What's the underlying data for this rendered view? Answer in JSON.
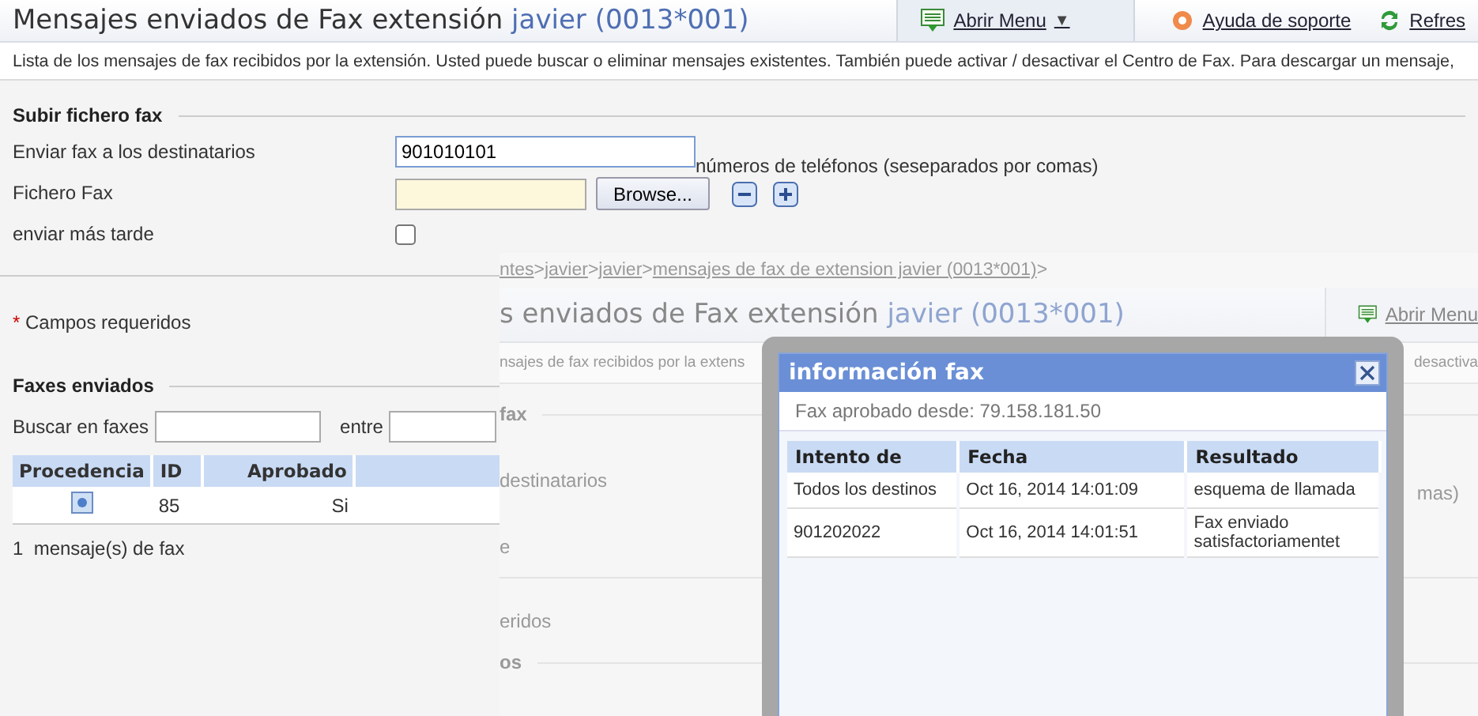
{
  "header": {
    "title": "Mensajes enviados de Fax extensión",
    "extension": "javier (0013*001)",
    "actions": [
      {
        "kind": "menu",
        "label": "Abrir Menu",
        "caret": "▼"
      },
      {
        "kind": "help",
        "label": "Ayuda de soporte"
      },
      {
        "kind": "refresh",
        "label": "Refres"
      }
    ]
  },
  "description": "Lista de los mensajes de fax recibidos por la extensión. Usted puede buscar o eliminar mensajes existentes. También puede activar / desactivar el Centro de Fax. Para descargar un mensaje,",
  "upload": {
    "heading": "Subir fichero fax",
    "recipients": {
      "label": "Enviar fax a los destinatarios",
      "value": "901010101",
      "hint": "números de teléfonos (seseparados por comas)"
    },
    "file": {
      "label": "Fichero Fax",
      "button": "Browse..."
    },
    "later": {
      "label": "enviar más tarde",
      "checked": false
    }
  },
  "required_note": {
    "mark": "*",
    "text": "Campos requeridos"
  },
  "sent": {
    "heading": "Faxes enviados",
    "search_label": "Buscar en faxes",
    "between_label": "entre",
    "columns": [
      "Procedencia",
      "ID",
      "Aprobado"
    ],
    "rows": [
      {
        "id": "85",
        "approved": "Si"
      }
    ],
    "count": "1  mensaje(s) de fax"
  },
  "overlay_screenshot": {
    "breadcrumb": [
      {
        "text": "ntes",
        "link": true
      },
      {
        "text": ">",
        "link": false
      },
      {
        "text": "javier",
        "link": true
      },
      {
        "text": ">",
        "link": false
      },
      {
        "text": "javier",
        "link": true
      },
      {
        "text": ">",
        "link": false
      },
      {
        "text": "mensajes de fax de extension javier (0013*001)",
        "link": true
      },
      {
        "text": ">",
        "link": false
      }
    ],
    "title": "s enviados de Fax extensión",
    "extension": "javier (0013*001)",
    "menu_button": "Abrir Menu",
    "description_start": "nsajes de fax recibidos por la extens",
    "description_end": "desactiva",
    "lines": [
      {
        "kind": "heading",
        "text": "fax"
      },
      {
        "kind": "label",
        "text": "destinatarios",
        "right": "mas)"
      },
      {
        "kind": "label",
        "text": "e"
      },
      {
        "kind": "rule"
      },
      {
        "kind": "label",
        "text": "eridos"
      },
      {
        "kind": "heading",
        "text": "os"
      }
    ]
  },
  "dialog": {
    "title": "información fax",
    "source": "Fax aprobado desde: 79.158.181.50",
    "columns": [
      "Intento de",
      "Fecha",
      "Resultado"
    ],
    "rows": [
      [
        "Todos los destinos",
        "Oct 16, 2014 14:01:09",
        "esquema de llamada"
      ],
      [
        "901202022",
        "Oct 16, 2014 14:01:51",
        "Fax enviado satisfactoriamentet"
      ]
    ]
  }
}
